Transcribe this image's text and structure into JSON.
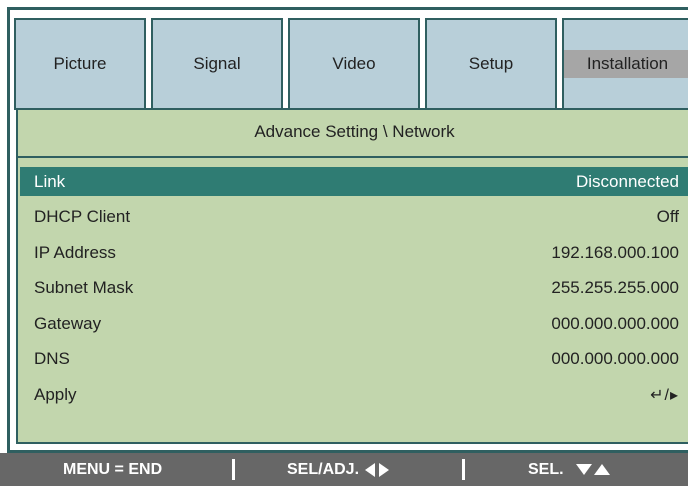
{
  "tabs": [
    {
      "label": "Picture",
      "active": false
    },
    {
      "label": "Signal",
      "active": false
    },
    {
      "label": "Video",
      "active": false
    },
    {
      "label": "Setup",
      "active": false
    },
    {
      "label": "Installation",
      "active": true
    }
  ],
  "panel": {
    "title": "Advance Setting \\ Network",
    "rows": [
      {
        "label": "Link",
        "value": "Disconnected",
        "selected": true
      },
      {
        "label": "DHCP Client",
        "value": "Off"
      },
      {
        "label": "IP Address",
        "value": "192.168.000.100"
      },
      {
        "label": "Subnet Mask",
        "value": "255.255.255.000"
      },
      {
        "label": "Gateway",
        "value": "000.000.000.000"
      },
      {
        "label": "DNS",
        "value": "000.000.000.000"
      },
      {
        "label": "Apply",
        "value": "↵/▸",
        "icon": "enter-right-icon"
      }
    ]
  },
  "footer": {
    "menu_end": "MENU = END",
    "sel_adj": "SEL/ADJ.",
    "sel": "SEL.",
    "icons": [
      "left-triangle-icon",
      "right-triangle-icon",
      "down-triangle-icon",
      "up-triangle-icon"
    ]
  },
  "colors": {
    "frame": "#2f5f60",
    "tab_bg": "#b8cfd9",
    "active_label_bg": "#a6a6a6",
    "panel_bg": "#c2d6ad",
    "selected_row": "#2f7c73",
    "footer_bg": "#676767"
  }
}
